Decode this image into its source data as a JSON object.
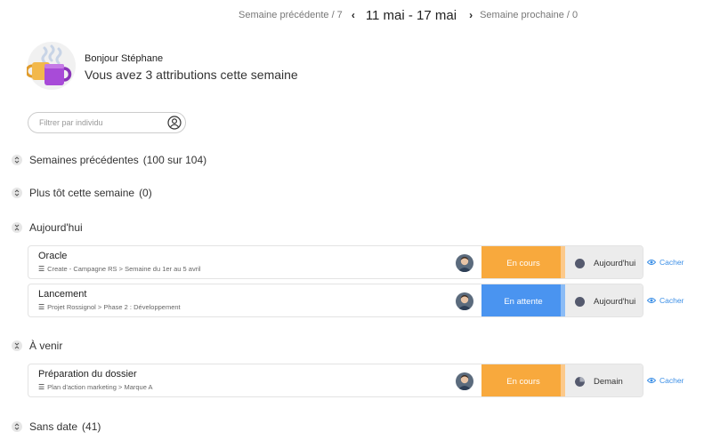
{
  "week_nav": {
    "prev_label": "Semaine précédente / 7",
    "current_week": "11 mai - 17 mai",
    "next_label": "Semaine prochaine / 0",
    "prev_icon": "chevron-left-icon",
    "next_icon": "chevron-right-icon"
  },
  "header": {
    "greeting": "Bonjour Stéphane",
    "summary": "Vous avez 3 attributions cette semaine",
    "illustration": "coffee-mugs-illustration"
  },
  "filter": {
    "placeholder": "Filtrer par individu",
    "value": "",
    "icon": "user-circle-icon"
  },
  "sections": {
    "previous_weeks": {
      "label": "Semaines précédentes",
      "count": "(100 sur 104)",
      "expanded": false
    },
    "earlier_this_week": {
      "label": "Plus tôt cette semaine",
      "count": "(0)",
      "expanded": false
    },
    "today": {
      "label": "Aujourd'hui",
      "expanded": true
    },
    "upcoming": {
      "label": "À venir",
      "expanded": true
    },
    "no_date": {
      "label": "Sans date",
      "count": "(41)",
      "expanded": false
    }
  },
  "tasks": [
    {
      "title": "Oracle",
      "path": "Create - Campagne RS > Semaine du 1er au 5 avril",
      "status": "En cours",
      "status_color": "#f8a93d",
      "stripe_color": "#fcc98a",
      "due": "Aujourd'hui",
      "hide": "Cacher"
    },
    {
      "title": "Lancement",
      "path": "Projet Rossignol > Phase 2 : Développement",
      "status": "En attente",
      "status_color": "#4a94f0",
      "stripe_color": "#8bbcf6",
      "due": "Aujourd'hui",
      "hide": "Cacher"
    },
    {
      "title": "Préparation du dossier",
      "path": "Plan d'action marketing > Marque A",
      "status": "En cours",
      "status_color": "#f8a93d",
      "stripe_color": "#fcc98a",
      "due": "Demain",
      "hide": "Cacher"
    }
  ],
  "colors": {
    "accent_link": "#3a8ee6",
    "due_background": "#ececec"
  }
}
